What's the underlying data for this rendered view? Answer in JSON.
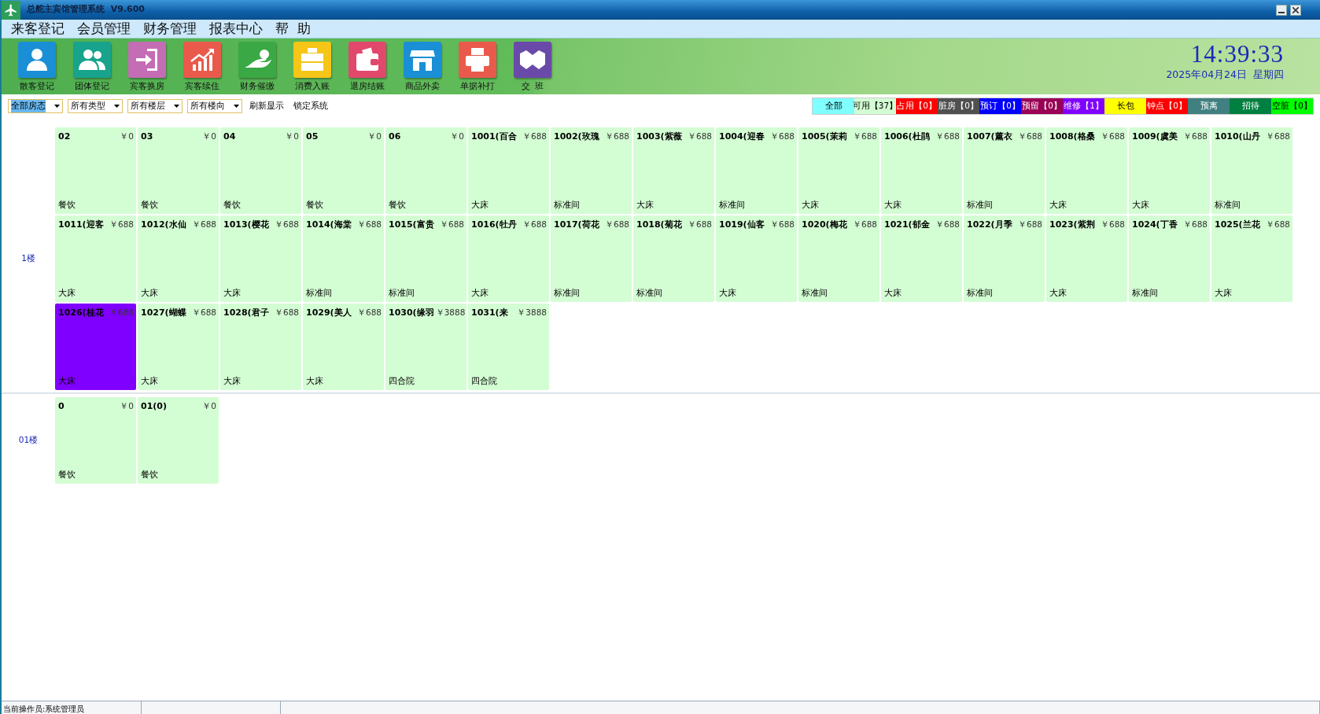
{
  "window": {
    "title": "总舵主宾馆管理系统  V9.600"
  },
  "menu": [
    "来客登记",
    "会员管理",
    "财务管理",
    "报表中心",
    "帮  助"
  ],
  "toolbar": [
    {
      "label": "散客登记",
      "color": "#1a8fd6"
    },
    {
      "label": "团体登记",
      "color": "#17a38c"
    },
    {
      "label": "宾客换房",
      "color": "#c46cb4"
    },
    {
      "label": "宾客续住",
      "color": "#ea5a4c"
    },
    {
      "label": "财务催缴",
      "color": "#3aa845"
    },
    {
      "label": "消费入账",
      "color": "#f5c518"
    },
    {
      "label": "退房结账",
      "color": "#e2476c"
    },
    {
      "label": "商品外卖",
      "color": "#1a8fd6"
    },
    {
      "label": "单据补打",
      "color": "#ea5a4c"
    },
    {
      "label": "交  班",
      "color": "#6a4aa8"
    }
  ],
  "clock": {
    "time": "14:39:33",
    "date": "2025年04月24日",
    "weekday": "星期四"
  },
  "filters": [
    {
      "value": "全部房态",
      "selected": true
    },
    {
      "value": "所有类型",
      "selected": false
    },
    {
      "value": "所有楼层",
      "selected": false
    },
    {
      "value": "所有楼向",
      "selected": false
    }
  ],
  "actions": [
    "刷新显示",
    "锁定系统"
  ],
  "legend": [
    {
      "label": "全部",
      "color": "#80ffff"
    },
    {
      "label": "可用【37】",
      "color": "#d3fdd3"
    },
    {
      "label": "占用【0】",
      "color": "#ff0000"
    },
    {
      "label": "脏房【0】",
      "color": "#505050"
    },
    {
      "label": "预订【0】",
      "color": "#0000ff"
    },
    {
      "label": "预留【0】",
      "color": "#990055"
    },
    {
      "label": "维修【1】",
      "color": "#8000ff"
    },
    {
      "label": "长包",
      "color": "#ffff00"
    },
    {
      "label": "钟点【0】",
      "color": "#ff0000"
    },
    {
      "label": "预离",
      "color": "#408080"
    },
    {
      "label": "招待",
      "color": "#008040"
    },
    {
      "label": "空脏【0】",
      "color": "#00ff00"
    }
  ],
  "floors": [
    {
      "label": "1楼",
      "rooms": [
        {
          "number": "02",
          "price": "￥0",
          "type": "餐饮",
          "maintenance": false
        },
        {
          "number": "03",
          "price": "￥0",
          "type": "餐饮",
          "maintenance": false
        },
        {
          "number": "04",
          "price": "￥0",
          "type": "餐饮",
          "maintenance": false
        },
        {
          "number": "05",
          "price": "￥0",
          "type": "餐饮",
          "maintenance": false
        },
        {
          "number": "06",
          "price": "￥0",
          "type": "餐饮",
          "maintenance": false
        },
        {
          "number": "1001(百合",
          "price": "￥688",
          "type": "大床",
          "maintenance": false
        },
        {
          "number": "1002(玫瑰",
          "price": "￥688",
          "type": "标准间",
          "maintenance": false
        },
        {
          "number": "1003(紫薇",
          "price": "￥688",
          "type": "大床",
          "maintenance": false
        },
        {
          "number": "1004(迎春",
          "price": "￥688",
          "type": "标准间",
          "maintenance": false
        },
        {
          "number": "1005(茉莉",
          "price": "￥688",
          "type": "大床",
          "maintenance": false
        },
        {
          "number": "1006(杜鹃",
          "price": "￥688",
          "type": "大床",
          "maintenance": false
        },
        {
          "number": "1007(薰衣",
          "price": "￥688",
          "type": "标准间",
          "maintenance": false
        },
        {
          "number": "1008(格桑",
          "price": "￥688",
          "type": "大床",
          "maintenance": false
        },
        {
          "number": "1009(虞美",
          "price": "￥688",
          "type": "大床",
          "maintenance": false
        },
        {
          "number": "1010(山丹",
          "price": "￥688",
          "type": "标准间",
          "maintenance": false
        },
        {
          "number": "1011(迎客",
          "price": "￥688",
          "type": "大床",
          "maintenance": false
        },
        {
          "number": "1012(水仙",
          "price": "￥688",
          "type": "大床",
          "maintenance": false
        },
        {
          "number": "1013(樱花",
          "price": "￥688",
          "type": "大床",
          "maintenance": false
        },
        {
          "number": "1014(海棠",
          "price": "￥688",
          "type": "标准间",
          "maintenance": false
        },
        {
          "number": "1015(富贵",
          "price": "￥688",
          "type": "标准间",
          "maintenance": false
        },
        {
          "number": "1016(牡丹",
          "price": "￥688",
          "type": "大床",
          "maintenance": false
        },
        {
          "number": "1017(荷花",
          "price": "￥688",
          "type": "标准间",
          "maintenance": false
        },
        {
          "number": "1018(菊花",
          "price": "￥688",
          "type": "标准间",
          "maintenance": false
        },
        {
          "number": "1019(仙客",
          "price": "￥688",
          "type": "大床",
          "maintenance": false
        },
        {
          "number": "1020(梅花",
          "price": "￥688",
          "type": "标准间",
          "maintenance": false
        },
        {
          "number": "1021(郁金",
          "price": "￥688",
          "type": "大床",
          "maintenance": false
        },
        {
          "number": "1022(月季",
          "price": "￥688",
          "type": "标准间",
          "maintenance": false
        },
        {
          "number": "1023(紫荆",
          "price": "￥688",
          "type": "大床",
          "maintenance": false
        },
        {
          "number": "1024(丁香",
          "price": "￥688",
          "type": "标准间",
          "maintenance": false
        },
        {
          "number": "1025(兰花",
          "price": "￥688",
          "type": "大床",
          "maintenance": false
        },
        {
          "number": "1026(桂花",
          "price": "￥688",
          "type": "大床",
          "maintenance": true
        },
        {
          "number": "1027(蝴蝶",
          "price": "￥688",
          "type": "大床",
          "maintenance": false
        },
        {
          "number": "1028(君子",
          "price": "￥688",
          "type": "大床",
          "maintenance": false
        },
        {
          "number": "1029(美人",
          "price": "￥688",
          "type": "大床",
          "maintenance": false
        },
        {
          "number": "1030(缘羽",
          "price": "￥3888",
          "type": "四合院",
          "maintenance": false
        },
        {
          "number": "1031(来",
          "price": "￥3888",
          "type": "四合院",
          "maintenance": false
        }
      ]
    },
    {
      "label": "01楼",
      "rooms": [
        {
          "number": "0",
          "price": "￥0",
          "type": "餐饮",
          "maintenance": false
        },
        {
          "number": "01(0)",
          "price": "￥0",
          "type": "餐饮",
          "maintenance": false
        }
      ]
    }
  ],
  "status_bar": {
    "operator": "当前操作员:系统管理员"
  }
}
